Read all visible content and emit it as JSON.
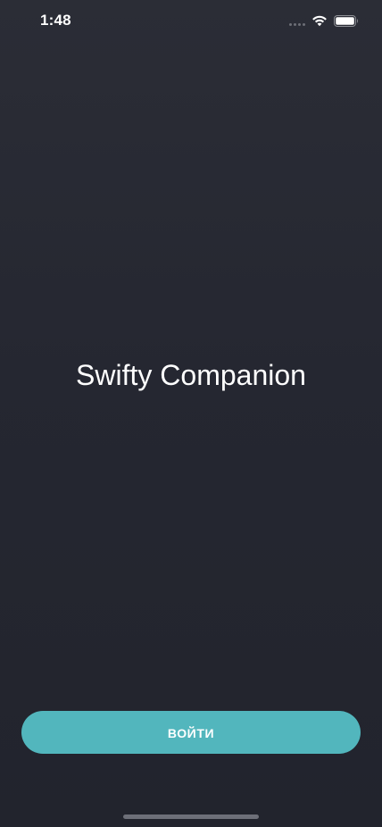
{
  "status_bar": {
    "time": "1:48",
    "icons": [
      "signal-dots-icon",
      "wifi-icon",
      "battery-icon"
    ]
  },
  "main": {
    "title": "Swifty Companion"
  },
  "actions": {
    "login_label": "ВОЙТИ"
  },
  "colors": {
    "background_top": "#2b2d36",
    "background_bottom": "#22242d",
    "accent": "#52b6bd",
    "text": "#ffffff"
  }
}
